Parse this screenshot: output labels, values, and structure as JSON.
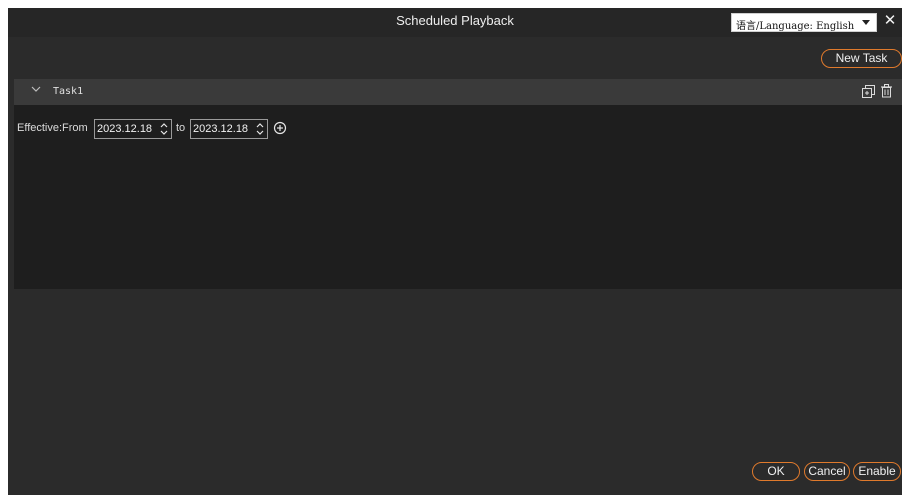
{
  "window": {
    "title": "Scheduled Playback"
  },
  "language": {
    "selected": "语言/Language: English"
  },
  "toolbar": {
    "new_task_label": "New Task"
  },
  "task": {
    "name": "Task1",
    "effective_label": "Effective:From",
    "from_date": "2023.12.18",
    "to_label": "to",
    "to_date": "2023.12.18"
  },
  "footer": {
    "ok_label": "OK",
    "cancel_label": "Cancel",
    "enable_label": "Enable"
  },
  "colors": {
    "accent": "#e07a2c",
    "background": "#2b2b2b",
    "panel": "#1e1e1e",
    "header": "#3a3a3a"
  },
  "icons": [
    "chevron-down-icon",
    "copy-icon",
    "trash-icon",
    "spin-arrows-icon",
    "add-circle-icon",
    "close-icon",
    "dropdown-caret-icon"
  ]
}
